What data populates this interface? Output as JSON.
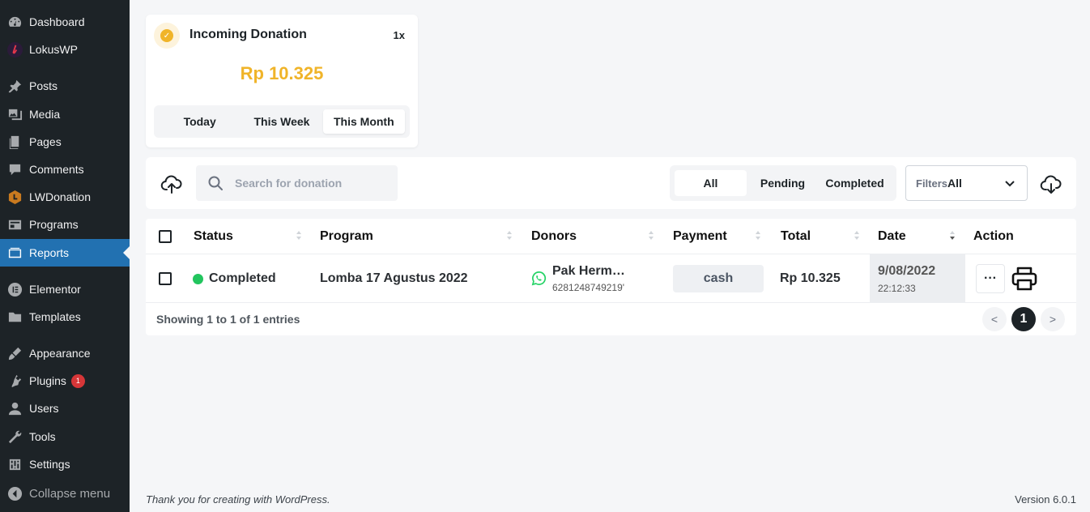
{
  "sidebar": {
    "items": [
      {
        "label": "Dashboard",
        "icon": "dashboard-icon"
      },
      {
        "label": "LokusWP",
        "icon": "lokuswp-logo-icon"
      },
      {
        "label": "Posts",
        "icon": "pin-icon"
      },
      {
        "label": "Media",
        "icon": "media-icon"
      },
      {
        "label": "Pages",
        "icon": "pages-icon"
      },
      {
        "label": "Comments",
        "icon": "comment-icon"
      },
      {
        "label": "LWDonation",
        "icon": "lwdonation-icon"
      },
      {
        "label": "Programs",
        "icon": "programs-icon"
      },
      {
        "label": "Reports",
        "icon": "reports-icon",
        "active": true
      },
      {
        "label": "Elementor",
        "icon": "elementor-icon"
      },
      {
        "label": "Templates",
        "icon": "folder-icon"
      },
      {
        "label": "Appearance",
        "icon": "brush-icon"
      },
      {
        "label": "Plugins",
        "icon": "plugin-icon",
        "badge": "1"
      },
      {
        "label": "Users",
        "icon": "user-icon"
      },
      {
        "label": "Tools",
        "icon": "wrench-icon"
      },
      {
        "label": "Settings",
        "icon": "settings-icon"
      }
    ],
    "collapse_label": "Collapse menu"
  },
  "summary_card": {
    "title": "Incoming Donation",
    "count": "1x",
    "amount": "Rp 10.325",
    "tabs": [
      "Today",
      "This Week",
      "This Month"
    ],
    "selected_tab": "This Month"
  },
  "toolbar": {
    "search_placeholder": "Search for donation",
    "status_tabs": [
      "All",
      "Pending",
      "Completed"
    ],
    "selected_status": "All",
    "filter_label": "Filters",
    "filter_value": "All"
  },
  "table": {
    "columns": [
      "Status",
      "Program",
      "Donors",
      "Payment",
      "Total",
      "Date",
      "Action"
    ],
    "rows": [
      {
        "status": "Completed",
        "program": "Lomba 17 Agustus 2022",
        "donor_name": "Pak Herm…",
        "donor_phone": "6281248749219'",
        "payment": "cash",
        "total": "Rp 10.325",
        "date": "9/08/2022",
        "time": "22:12:33",
        "more_label": "···"
      }
    ],
    "showing_text": "Showing 1 to 1 of 1 entries",
    "pagination": {
      "prev": "<",
      "current": "1",
      "next": ">"
    }
  },
  "colors": {
    "accent": "#f0b429",
    "active_menu": "#2271b1",
    "sidebar_bg": "#1d2327",
    "status_completed": "#22c55e"
  },
  "footer": {
    "thanks_prefix": "Thank you for creating with ",
    "thanks_link": "WordPress",
    "thanks_suffix": ".",
    "version": "Version 6.0.1"
  }
}
